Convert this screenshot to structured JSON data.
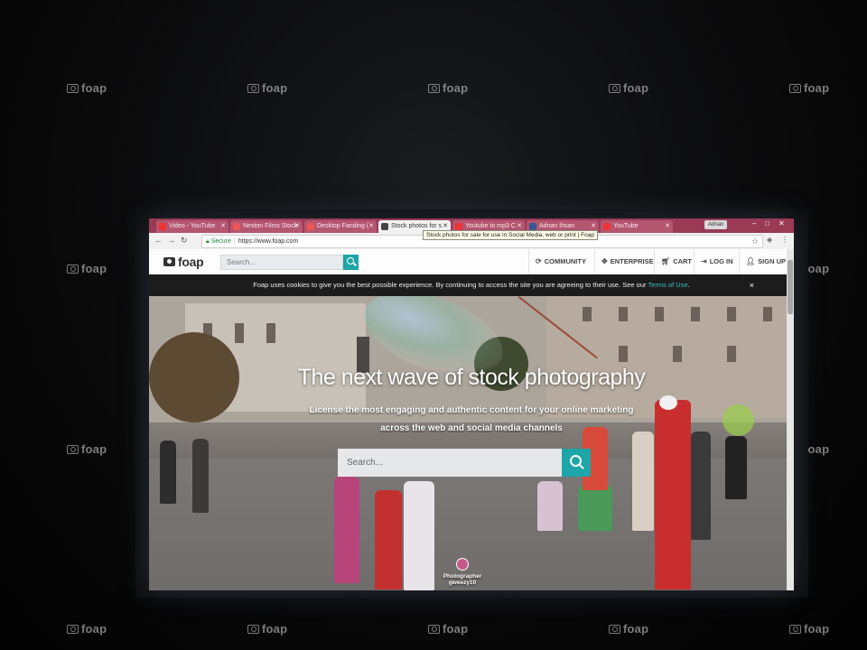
{
  "watermark": {
    "text": "foap"
  },
  "browser": {
    "tabs": [
      {
        "label": "Video - YouTube",
        "fav_color": "#e33"
      },
      {
        "label": "Nexton Films Stock",
        "fav_color": "#e55"
      },
      {
        "label": "Desktop Fanding (",
        "fav_color": "#e55"
      },
      {
        "label": "Stock photos for s",
        "fav_color": "#444"
      },
      {
        "label": "Youtube to mp3 C",
        "fav_color": "#e33"
      },
      {
        "label": "Adnan Ihsan",
        "fav_color": "#3b5998"
      },
      {
        "label": "YouTube",
        "fav_color": "#e33"
      }
    ],
    "user": "Adnan",
    "tooltip": "Stock photos for sale for use in Social Media, web or print | Foap",
    "secure_label": "Secure",
    "url": "https://www.foap.com"
  },
  "site": {
    "logo": "foap",
    "search_placeholder": "Search...",
    "nav": [
      {
        "label": "COMMUNITY",
        "icon": "community-icon"
      },
      {
        "label": "ENTERPRISE",
        "icon": "enterprise-icon"
      },
      {
        "label": "CART",
        "icon": "cart-icon"
      },
      {
        "label": "LOG IN",
        "icon": "login-icon"
      },
      {
        "label": "SIGN UP",
        "icon": "signup-icon"
      }
    ],
    "cookie_text": "Foap uses cookies to give you the best possible experience. By continuing to access the site you are agreeing to their use. See our",
    "cookie_link": "Terms of Use",
    "hero": {
      "title": "The next wave of stock photography",
      "subtitle_line1": "License the most engaging and authentic content for your online marketing",
      "subtitle_line2": "across the web and social media channels",
      "search_placeholder": "Search...",
      "credit": "Photographer gweezy10"
    }
  }
}
